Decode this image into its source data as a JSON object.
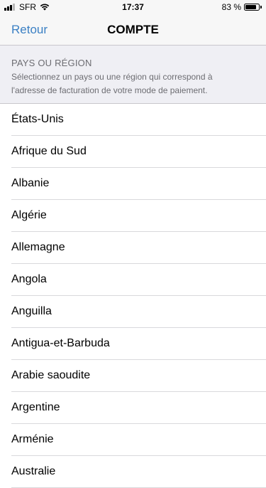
{
  "status_bar": {
    "carrier": "SFR",
    "time": "17:37",
    "battery": "83 %",
    "battery_level": 0.83,
    "signal_bars_filled": 3,
    "signal_bars_total": 4
  },
  "nav": {
    "back_label": "Retour",
    "title": "COMPTE"
  },
  "section": {
    "title": "PAYS OU RÉGION",
    "description_line1": "Sélectionnez un pays ou une région qui correspond à",
    "description_line2": "l'adresse de facturation de votre mode de paiement."
  },
  "countries": [
    "États-Unis",
    "Afrique du Sud",
    "Albanie",
    "Algérie",
    "Allemagne",
    "Angola",
    "Anguilla",
    "Antigua-et-Barbuda",
    "Arabie saoudite",
    "Argentine",
    "Arménie",
    "Australie"
  ],
  "colors": {
    "accent": "#3b80c4",
    "header_bg": "#efeff4",
    "bar_bg": "#f7f7f7",
    "secondary_text": "#6d6d72"
  },
  "icons": {
    "signal": "cellular-signal-icon",
    "wifi": "wifi-icon",
    "battery": "battery-icon"
  }
}
